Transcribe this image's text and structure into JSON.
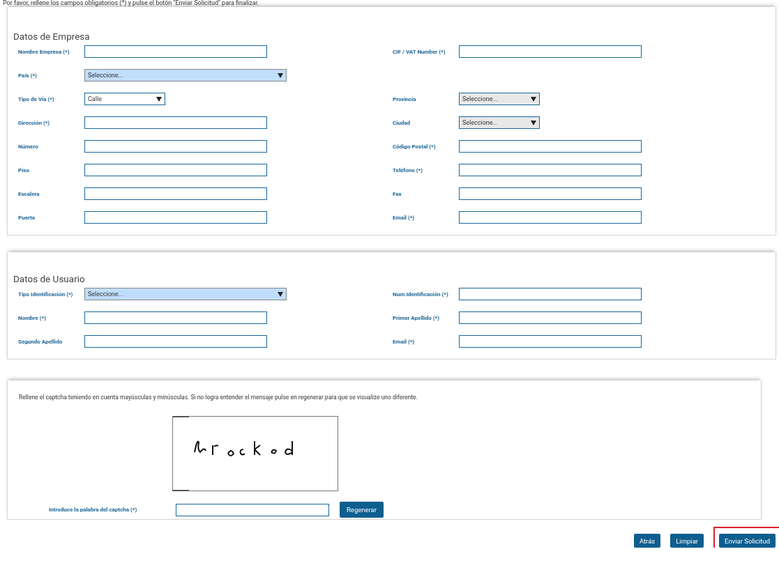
{
  "intro": "Por favor, rellene los campos obligatorios (*) y pulse el botón \"Enviar Solicitud\" para finalizar.",
  "empresa": {
    "title": "Datos de Empresa",
    "rows": [
      {
        "left": {
          "label": "Nombre Empresa (*)",
          "kind": "text"
        },
        "right": {
          "label": "CIF / VAT Number (*)",
          "kind": "text"
        }
      },
      {
        "left": {
          "label": "País (*)",
          "kind": "select",
          "value": "Seleccione...",
          "highlighted": true
        }
      },
      {
        "left": {
          "label": "Tipo de Vía (*)",
          "kind": "select",
          "value": "Calle",
          "highlighted": false
        },
        "right": {
          "label": "Provincia",
          "kind": "select",
          "value": "Seleccione...",
          "disabled": true
        }
      },
      {
        "left": {
          "label": "Dirección (*)",
          "kind": "text"
        },
        "right": {
          "label": "Ciudad",
          "kind": "select",
          "value": "Seleccione...",
          "disabled": true
        }
      },
      {
        "left": {
          "label": "Número",
          "kind": "text"
        },
        "right": {
          "label": "Código Postal (*)",
          "kind": "text"
        }
      },
      {
        "left": {
          "label": "Piso",
          "kind": "text"
        },
        "right": {
          "label": "Teléfono (*)",
          "kind": "text"
        }
      },
      {
        "left": {
          "label": "Escalera",
          "kind": "text"
        },
        "right": {
          "label": "Fax",
          "kind": "text"
        }
      },
      {
        "left": {
          "label": "Puerta",
          "kind": "text"
        },
        "right": {
          "label": "Email (*)",
          "kind": "text"
        }
      }
    ]
  },
  "usuario": {
    "title": "Datos de Usuario",
    "rows": [
      {
        "left": {
          "label": "Tipo Identificación (*)",
          "kind": "select",
          "value": "Seleccione...",
          "highlighted": true
        },
        "right": {
          "label": "Num.Identificación (*)",
          "kind": "text"
        }
      },
      {
        "left": {
          "label": "Nombre (*)",
          "kind": "text"
        },
        "right": {
          "label": "Primer Apellido (*)",
          "kind": "text"
        }
      },
      {
        "left": {
          "label": "Segundo Apellido",
          "kind": "text"
        },
        "right": {
          "label": "Email (*)",
          "kind": "text"
        }
      }
    ]
  },
  "captcha": {
    "instructions": "Rellene el captcha teniendo en cuenta mayúsculas y minúsculas. Si no logra entender el mensaje pulse en regenerar para que se visualize uno diferente.",
    "input_label": "Introduce la palabra del captcha (*)",
    "regenerate_button": "Regenerar"
  },
  "buttons": [
    {
      "label": "Atrás",
      "highlighted": false
    },
    {
      "label": "Limpiar",
      "highlighted": false
    },
    {
      "label": "Enviar Solicitud",
      "highlighted": true
    }
  ]
}
